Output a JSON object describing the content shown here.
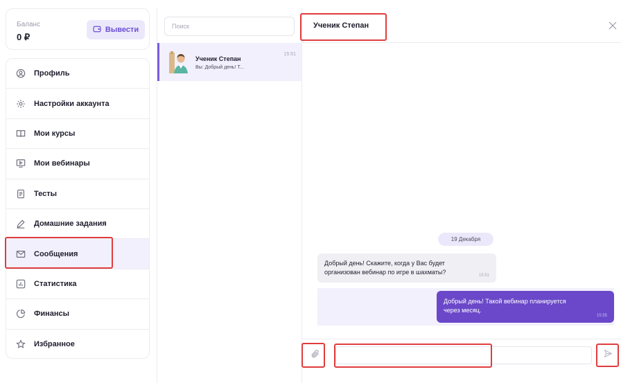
{
  "balance": {
    "label": "Баланс",
    "value": "0 ₽",
    "withdraw_label": "Вывести"
  },
  "menu": {
    "items": [
      {
        "label": "Профиль",
        "icon": "user-icon"
      },
      {
        "label": "Настройки аккаунта",
        "icon": "gear-icon"
      },
      {
        "label": "Мои курсы",
        "icon": "book-icon"
      },
      {
        "label": "Мои вебинары",
        "icon": "video-icon"
      },
      {
        "label": "Тесты",
        "icon": "document-icon"
      },
      {
        "label": "Домашние задания",
        "icon": "pencil-icon"
      },
      {
        "label": "Сообщения",
        "icon": "mail-icon",
        "active": true
      },
      {
        "label": "Статистика",
        "icon": "chart-icon"
      },
      {
        "label": "Финансы",
        "icon": "pie-chart-icon"
      },
      {
        "label": "Избранное",
        "icon": "star-icon"
      }
    ]
  },
  "chats": {
    "search_placeholder": "Поиск",
    "items": [
      {
        "name": "Ученик Степан",
        "preview": "Вы: Добрый день! Т...",
        "time": "15:51"
      }
    ]
  },
  "conversation": {
    "title": "Ученик Степан",
    "date_separator": "19 Декабря",
    "messages": [
      {
        "direction": "in",
        "text": "Добрый день! Скажите, когда у Вас будет организован вебинар по игре в шахматы?",
        "time": "15:51"
      },
      {
        "direction": "out",
        "text": "Добрый день! Такой вебинар планируется через месяц.",
        "time": "15:55"
      }
    ],
    "input_value": ""
  },
  "colors": {
    "accent": "#6a48c9",
    "accent_light": "#f3f0fd",
    "highlight": "#e03c3c"
  }
}
